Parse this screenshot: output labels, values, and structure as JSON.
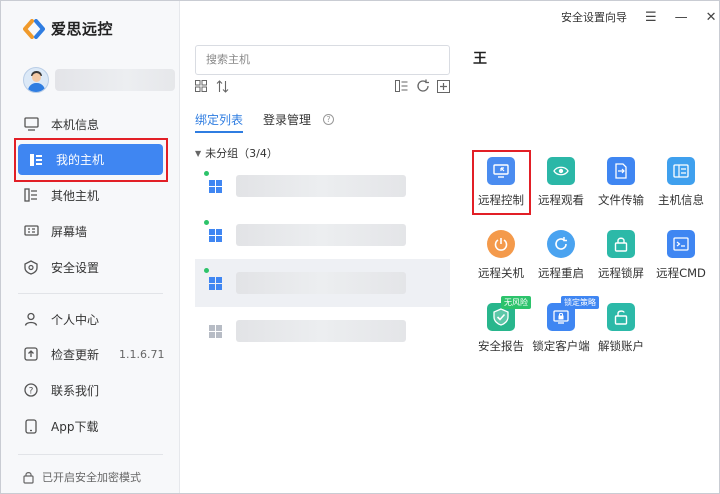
{
  "app": {
    "name": "爱思远控"
  },
  "topbar": {
    "security_guide": "安全设置向导",
    "menu": "☰",
    "minimize": "—",
    "close": "✕"
  },
  "sidebar": {
    "items_top": [
      {
        "label": "本机信息",
        "icon": "monitor-icon"
      },
      {
        "label": "我的主机",
        "icon": "host-list-icon"
      },
      {
        "label": "其他主机",
        "icon": "other-hosts-icon"
      },
      {
        "label": "屏幕墙",
        "icon": "screen-wall-icon"
      },
      {
        "label": "安全设置",
        "icon": "shield-icon"
      }
    ],
    "items_bottom": [
      {
        "label": "个人中心",
        "icon": "user-icon"
      },
      {
        "label": "检查更新",
        "icon": "update-icon"
      },
      {
        "label": "联系我们",
        "icon": "question-icon"
      },
      {
        "label": "App下载",
        "icon": "phone-icon"
      }
    ],
    "version": "1.1.6.71",
    "encrypt_status": "已开启安全加密模式"
  },
  "search": {
    "placeholder": "搜索主机"
  },
  "tabs": {
    "bind_list": "绑定列表",
    "login_manage": "登录管理"
  },
  "group": {
    "label": "未分组（3/4）"
  },
  "host_detail": {
    "title": "王",
    "functions": [
      {
        "label": "远程控制",
        "icon": "remote-control-icon",
        "color": "#4a8cf0"
      },
      {
        "label": "远程观看",
        "icon": "eye-icon",
        "color": "#2bb7a7"
      },
      {
        "label": "文件传输",
        "icon": "file-transfer-icon",
        "color": "#3f86f2"
      },
      {
        "label": "主机信息",
        "icon": "host-info-icon",
        "color": "#3fa0ee"
      },
      {
        "label": "远程关机",
        "icon": "power-icon",
        "color": "#f49a4b"
      },
      {
        "label": "远程重启",
        "icon": "restart-icon",
        "color": "#4aa3f0"
      },
      {
        "label": "远程锁屏",
        "icon": "lock-icon",
        "color": "#2cb9a8"
      },
      {
        "label": "远程CMD",
        "icon": "cmd-icon",
        "color": "#3f86f2"
      },
      {
        "label": "安全报告",
        "icon": "security-report-icon",
        "color": "#28b68c",
        "badge": "无风险",
        "badge_color": "#2cc36b"
      },
      {
        "label": "锁定客户端",
        "icon": "lock-client-icon",
        "color": "#3f86f2",
        "badge": "锁定策略",
        "badge_color": "#3f86f2"
      },
      {
        "label": "解锁账户",
        "icon": "unlock-account-icon",
        "color": "#2cb9a8"
      }
    ]
  }
}
